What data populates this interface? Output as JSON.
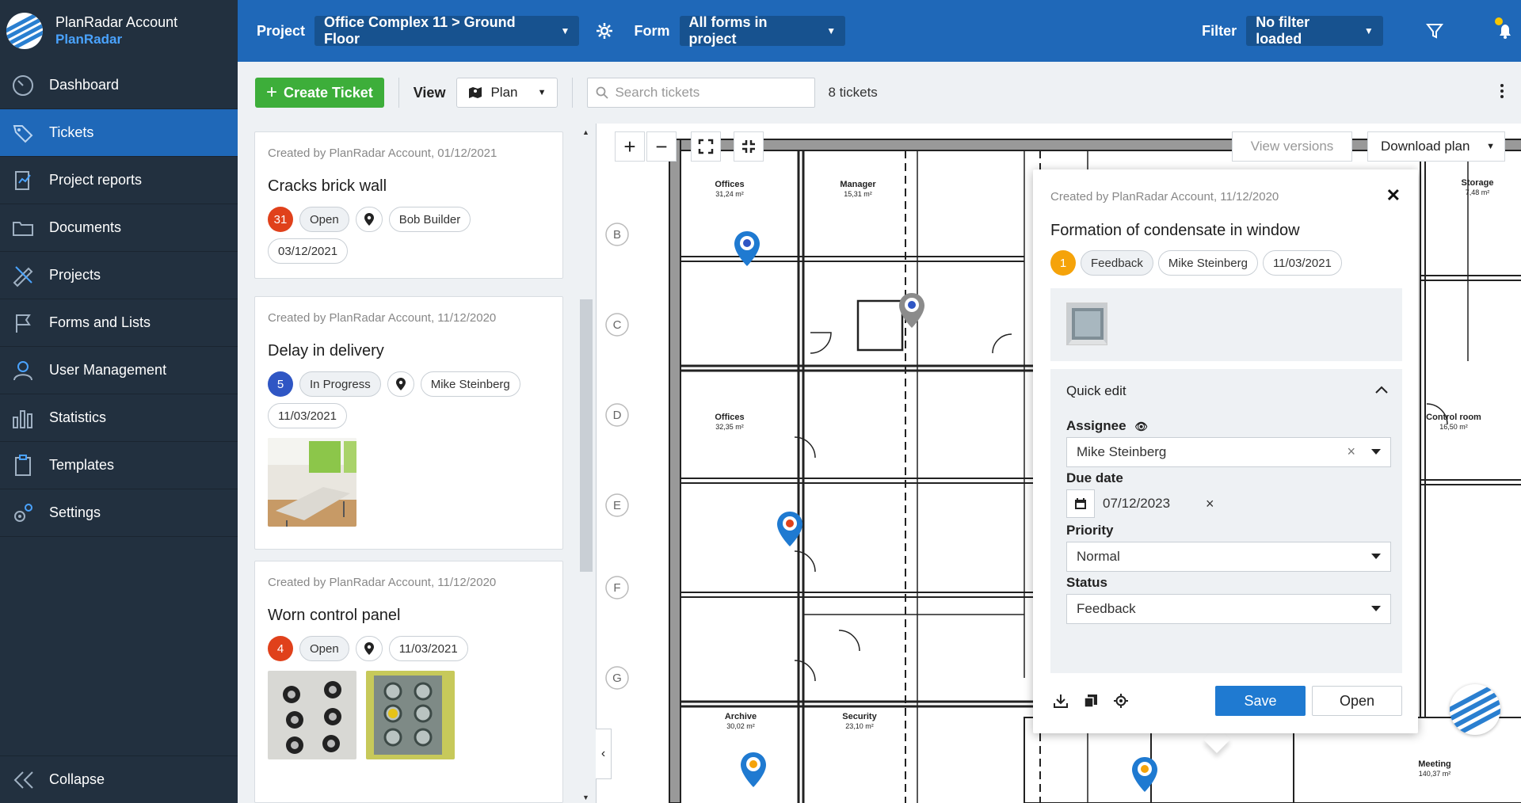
{
  "account": {
    "name": "PlanRadar Account",
    "brand": "PlanRadar"
  },
  "sidebar": {
    "items": [
      {
        "label": "Dashboard",
        "icon": "dashboard-gauge-icon",
        "active": false
      },
      {
        "label": "Tickets",
        "icon": "ticket-tag-icon",
        "active": true
      },
      {
        "label": "Project reports",
        "icon": "report-icon",
        "active": false
      },
      {
        "label": "Documents",
        "icon": "folder-icon",
        "active": false
      },
      {
        "label": "Projects",
        "icon": "ruler-pencil-icon",
        "active": false
      },
      {
        "label": "Forms and Lists",
        "icon": "flag-icon",
        "active": false
      },
      {
        "label": "User Management",
        "icon": "user-icon",
        "active": false
      },
      {
        "label": "Statistics",
        "icon": "bar-chart-icon",
        "active": false
      },
      {
        "label": "Templates",
        "icon": "clipboard-icon",
        "active": false
      },
      {
        "label": "Settings",
        "icon": "gear-icon",
        "active": false
      }
    ],
    "collapse_label": "Collapse"
  },
  "topbar": {
    "project_label": "Project",
    "project_value": "Office Complex 11 > Ground Floor",
    "form_label": "Form",
    "form_value": "All forms in project",
    "filter_label": "Filter",
    "filter_value": "No filter loaded"
  },
  "toolbar": {
    "create_label": "Create Ticket",
    "view_label": "View",
    "view_value": "Plan",
    "search_placeholder": "Search tickets",
    "ticket_count": "8 tickets"
  },
  "tickets": [
    {
      "meta": "Created by PlanRadar Account, 01/12/2021",
      "title": "Cracks brick wall",
      "number": "31",
      "number_color": "#e0411b",
      "status": "Open",
      "assignee": "Bob Builder",
      "date": "03/12/2021"
    },
    {
      "meta": "Created by PlanRadar Account, 11/12/2020",
      "title": "Delay in delivery",
      "number": "5",
      "number_color": "#2f56c4",
      "status": "In Progress",
      "assignee": "Mike Steinberg",
      "date": "11/03/2021"
    },
    {
      "meta": "Created by PlanRadar Account, 11/12/2020",
      "title": "Worn control panel",
      "number": "4",
      "number_color": "#e0411b",
      "status": "Open",
      "date": "11/03/2021"
    }
  ],
  "plan": {
    "view_versions": "View versions",
    "download_plan": "Download plan",
    "row_labels": [
      "B",
      "C",
      "D",
      "E",
      "F",
      "G"
    ],
    "rooms": [
      {
        "name": "Offices",
        "area": "31,24 m²"
      },
      {
        "name": "Manager",
        "area": "15,31 m²"
      },
      {
        "name": "Offices",
        "area": "32,35 m²"
      },
      {
        "name": "Archive",
        "area": "30,02 m²"
      },
      {
        "name": "Security",
        "area": "23,10 m²"
      },
      {
        "name": "Storage",
        "area": "7,48 m²"
      },
      {
        "name": "Control room",
        "area": "16,50 m²"
      },
      {
        "name": "Meeting",
        "area": "140,37 m²"
      }
    ]
  },
  "popup": {
    "meta": "Created by PlanRadar Account, 11/12/2020",
    "title": "Formation of condensate in window",
    "number": "1",
    "number_color": "#f5a30a",
    "status": "Feedback",
    "assignee": "Mike Steinberg",
    "date": "11/03/2021",
    "quick_edit": {
      "heading": "Quick edit",
      "assignee_label": "Assignee",
      "assignee_value": "Mike Steinberg",
      "due_label": "Due date",
      "due_value": "07/12/2023",
      "priority_label": "Priority",
      "priority_value": "Normal",
      "status_label": "Status",
      "status_value": "Feedback"
    },
    "save_label": "Save",
    "open_label": "Open"
  },
  "colors": {
    "brand_blue": "#1f68b8",
    "sidebar_bg": "#22303f",
    "create_green": "#3dae3a",
    "save_blue": "#1f7ad1"
  }
}
